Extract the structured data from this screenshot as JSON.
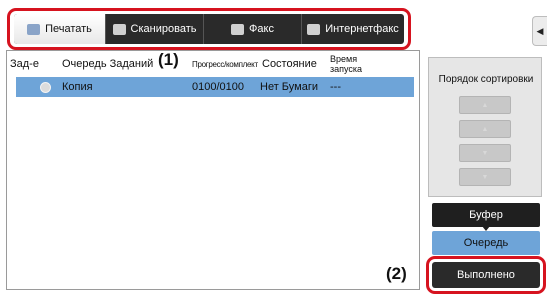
{
  "tabs": [
    {
      "label": "Печатать",
      "icon": "print-icon",
      "active": true
    },
    {
      "label": "Сканировать",
      "icon": "scan-icon",
      "active": false
    },
    {
      "label": "Факс",
      "icon": "fax-icon",
      "active": false
    },
    {
      "label": "Интернетфакс",
      "icon": "internet-fax-icon",
      "active": false
    }
  ],
  "side_tab": {
    "icon": "side-arrow-icon",
    "glyph": "◀"
  },
  "table": {
    "headers": {
      "job": "Зад-е",
      "queue": "Очередь Заданий",
      "progress": "Прогресс/комплект",
      "status": "Состояние",
      "start_line1": "Время",
      "start_line2": "запуска"
    },
    "rows": [
      {
        "icon": "copy-job-icon",
        "name": "Копия",
        "progress": "0100/0100",
        "status": "Нет Бумаги",
        "start": "---",
        "selected": true
      }
    ]
  },
  "callouts": {
    "tabs": "(1)",
    "done": "(2)"
  },
  "sort": {
    "title": "Порядок сортировки",
    "buttons": [
      "move-top-button",
      "move-up-button",
      "move-down-button",
      "move-bottom-button"
    ]
  },
  "buttons": {
    "buffer": "Буфер",
    "queue": "Очередь",
    "done": "Выполнено"
  },
  "colors": {
    "highlight": "#d6131f",
    "selected_row": "#6ea4d8",
    "tab_bar": "#2a2a2a"
  }
}
